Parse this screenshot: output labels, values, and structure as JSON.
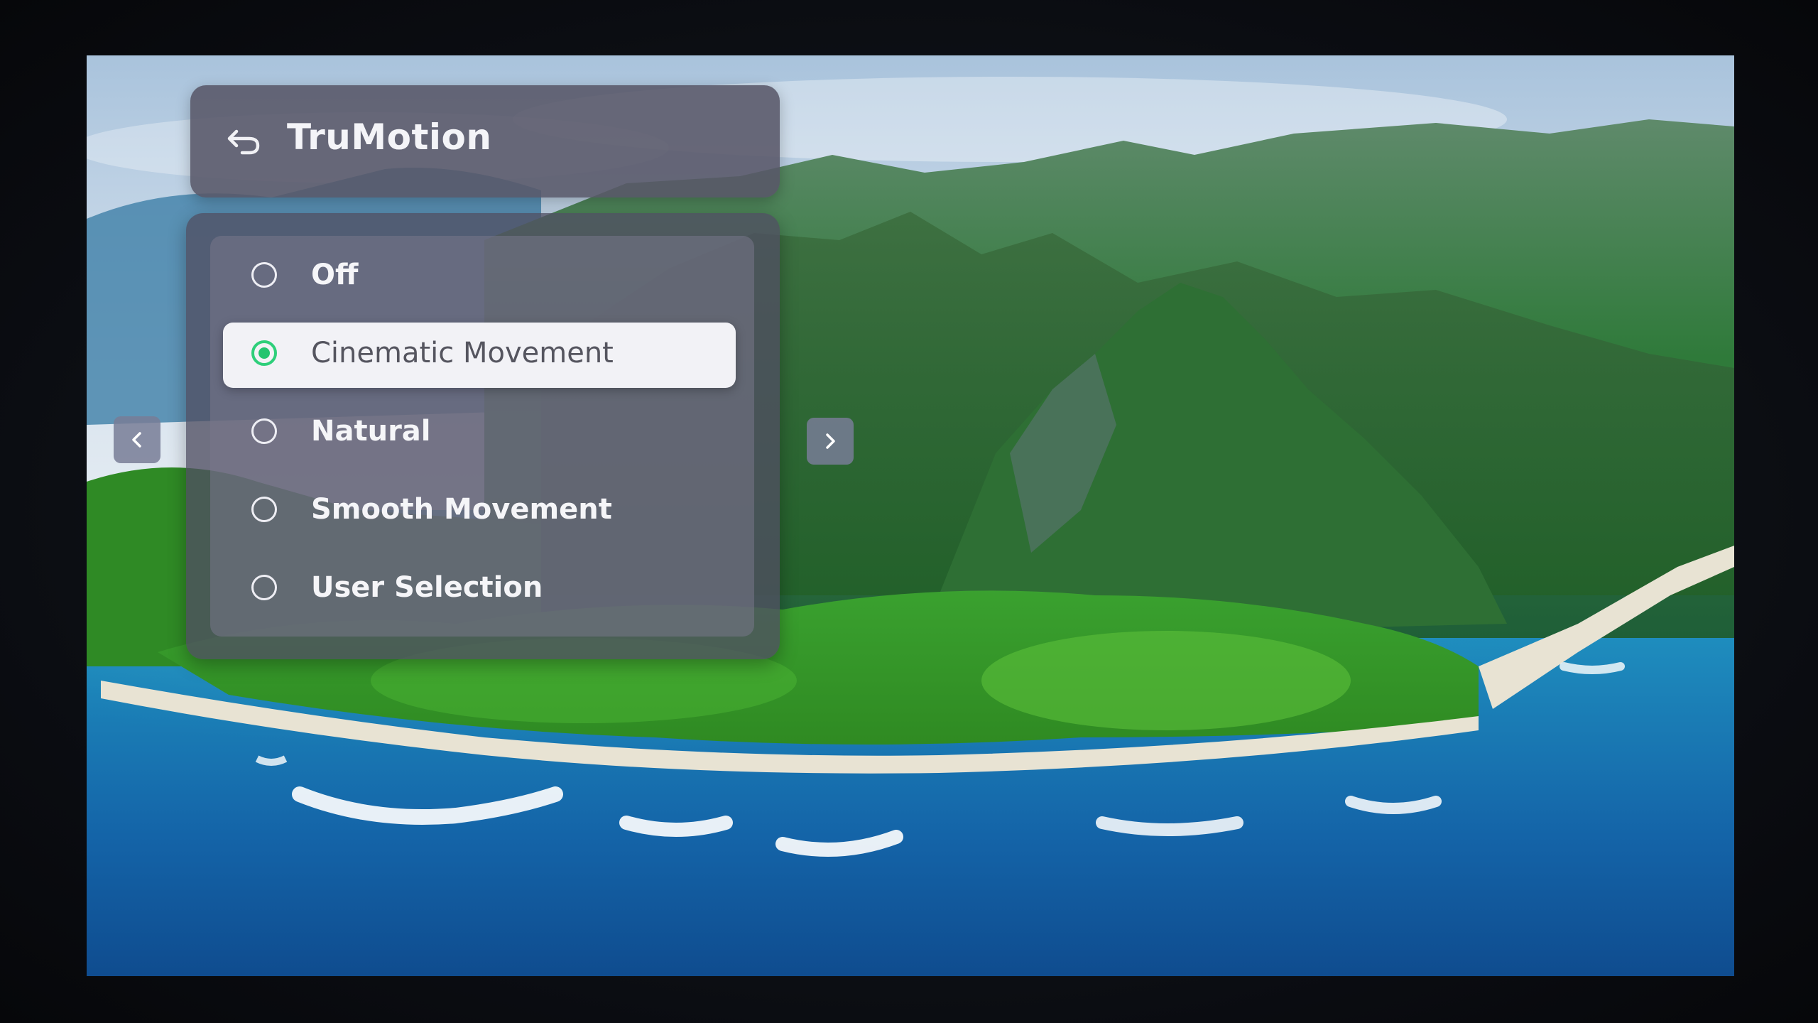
{
  "menu": {
    "title": "TruMotion",
    "back_icon": "back-arrow-icon"
  },
  "options": [
    {
      "label": "Off",
      "selected": false
    },
    {
      "label": "Cinematic Movement",
      "selected": true
    },
    {
      "label": "Natural",
      "selected": false
    },
    {
      "label": "Smooth Movement",
      "selected": false
    },
    {
      "label": "User Selection",
      "selected": false
    }
  ],
  "navigation": {
    "left_icon": "chevron-left-icon",
    "right_icon": "chevron-right-icon"
  },
  "colors": {
    "selected_radio": "#23c46f",
    "selected_row": "#f2f2f6",
    "panel": "#504e62"
  },
  "background": {
    "description_icon": "landscape-wallpaper"
  }
}
